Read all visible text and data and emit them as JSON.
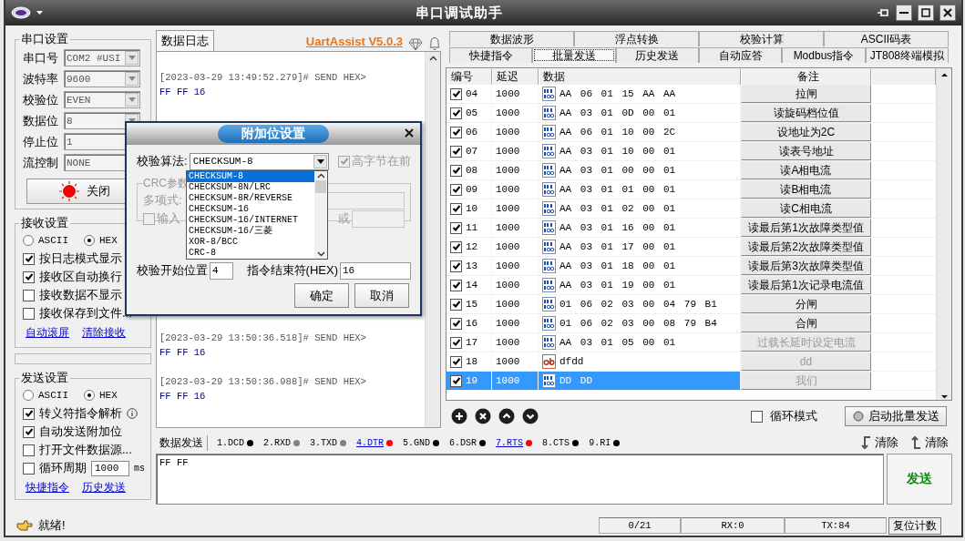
{
  "window": {
    "title": "串口调试助手"
  },
  "serial_settings": {
    "title": "串口设置",
    "fields": [
      {
        "label": "串口号",
        "value": "COM2 #USI"
      },
      {
        "label": "波特率",
        "value": "9600"
      },
      {
        "label": "校验位",
        "value": "EVEN"
      },
      {
        "label": "数据位",
        "value": "8"
      },
      {
        "label": "停止位",
        "value": "1"
      },
      {
        "label": "流控制",
        "value": "NONE"
      }
    ],
    "open_button": {
      "label": "关闭",
      "on": true
    }
  },
  "receive_settings": {
    "title": "接收设置",
    "modes": [
      {
        "label": "ASCII",
        "selected": false
      },
      {
        "label": "HEX",
        "selected": true
      }
    ],
    "options": [
      {
        "label": "按日志模式显示",
        "checked": true
      },
      {
        "label": "接收区自动换行",
        "checked": true
      },
      {
        "label": "接收数据不显示",
        "checked": false
      },
      {
        "label": "接收保存到文件...",
        "checked": false
      }
    ],
    "links": [
      "自动滚屏",
      "清除接收"
    ]
  },
  "send_settings": {
    "title": "发送设置",
    "modes": [
      {
        "label": "ASCII",
        "selected": false
      },
      {
        "label": "HEX",
        "selected": true
      }
    ],
    "options": [
      {
        "kind": "info",
        "label": "转义符指令解析",
        "checked": true
      },
      {
        "kind": "plain",
        "label": "自动发送附加位",
        "checked": true
      },
      {
        "kind": "plain",
        "label": "打开文件数据源...",
        "checked": false
      },
      {
        "kind": "period",
        "label": "循环周期",
        "checked": false,
        "value": "1000",
        "unit": "ms"
      }
    ],
    "links": [
      "快捷指令",
      "历史发送"
    ]
  },
  "log": {
    "tab": "数据日志",
    "brand": "UartAssist V5.0.3",
    "entries": [
      {
        "header": "[2023-03-29 13:49:52.279]# SEND HEX>",
        "data": "FF FF 16"
      },
      {
        "header": "[2023-03-29 13:50:36.518]# SEND HEX>",
        "data": "FF FF 16"
      },
      {
        "header": "[2023-03-29 13:50:36.988]# SEND HEX>",
        "data": "FF FF 16"
      }
    ]
  },
  "tools": {
    "tab_rows": [
      [
        {
          "label": "数据波形",
          "selected": false
        },
        {
          "label": "浮点转换",
          "selected": false
        },
        {
          "label": "校验计算",
          "selected": false
        },
        {
          "label": "ASCII码表",
          "selected": false
        }
      ],
      [
        {
          "label": "快捷指令",
          "selected": false
        },
        {
          "label": "批量发送",
          "selected": true
        },
        {
          "label": "历史发送",
          "selected": false
        },
        {
          "label": "自动应答",
          "selected": false
        },
        {
          "label": "Modbus指令",
          "selected": false
        },
        {
          "label": "JT808终端模拟",
          "selected": false
        }
      ]
    ]
  },
  "batch": {
    "columns": [
      "编号",
      "延迟",
      "数据",
      "备注"
    ],
    "rows": [
      {
        "checked": true,
        "no": "04",
        "delay": "1000",
        "kind": "hex",
        "data": "AA 06 01 15 AA AA",
        "note": "拉闸",
        "disabled": false,
        "selected": false
      },
      {
        "checked": true,
        "no": "05",
        "delay": "1000",
        "kind": "hex",
        "data": "AA 03 01 0D 00 01",
        "note": "读旋码档位值",
        "disabled": false,
        "selected": false
      },
      {
        "checked": true,
        "no": "06",
        "delay": "1000",
        "kind": "hex",
        "data": "AA 06 01 10 00 2C",
        "note": "设地址为2C",
        "disabled": false,
        "selected": false
      },
      {
        "checked": true,
        "no": "07",
        "delay": "1000",
        "kind": "hex",
        "data": "AA 03 01 10 00 01",
        "note": "读表号地址",
        "disabled": false,
        "selected": false
      },
      {
        "checked": true,
        "no": "08",
        "delay": "1000",
        "kind": "hex",
        "data": "AA 03 01 00 00 01",
        "note": "读A相电流",
        "disabled": false,
        "selected": false
      },
      {
        "checked": true,
        "no": "09",
        "delay": "1000",
        "kind": "hex",
        "data": "AA 03 01 01 00 01",
        "note": "读B相电流",
        "disabled": false,
        "selected": false
      },
      {
        "checked": true,
        "no": "10",
        "delay": "1000",
        "kind": "hex",
        "data": "AA 03 01 02 00 01",
        "note": "读C相电流",
        "disabled": false,
        "selected": false
      },
      {
        "checked": true,
        "no": "11",
        "delay": "1000",
        "kind": "hex",
        "data": "AA 03 01 16 00 01",
        "note": "读最后第1次故障类型值",
        "disabled": false,
        "selected": false
      },
      {
        "checked": true,
        "no": "12",
        "delay": "1000",
        "kind": "hex",
        "data": "AA 03 01 17 00 01",
        "note": "读最后第2次故障类型值",
        "disabled": false,
        "selected": false
      },
      {
        "checked": true,
        "no": "13",
        "delay": "1000",
        "kind": "hex",
        "data": "AA 03 01 18 00 01",
        "note": "读最后第3次故障类型值",
        "disabled": false,
        "selected": false
      },
      {
        "checked": true,
        "no": "14",
        "delay": "1000",
        "kind": "hex",
        "data": "AA 03 01 19 00 01",
        "note": "读最后第1次记录电流值",
        "disabled": false,
        "selected": false
      },
      {
        "checked": true,
        "no": "15",
        "delay": "1000",
        "kind": "hex",
        "data": "01 06 02 03 00 04 79 B1",
        "note": "分闸",
        "disabled": false,
        "selected": false
      },
      {
        "checked": true,
        "no": "16",
        "delay": "1000",
        "kind": "hex",
        "data": "01 06 02 03 00 08 79 B4",
        "note": "合闸",
        "disabled": false,
        "selected": false
      },
      {
        "checked": true,
        "no": "17",
        "delay": "1000",
        "kind": "hex",
        "data": "AA 03 01 05 00 01",
        "note": "过载长延时设定电流",
        "disabled": true,
        "selected": false
      },
      {
        "checked": true,
        "no": "18",
        "delay": "1000",
        "kind": "ascii",
        "data": "dfdd",
        "note": "dd",
        "disabled": true,
        "selected": false
      },
      {
        "checked": true,
        "no": "19",
        "delay": "1000",
        "kind": "hex",
        "data": "DD DD",
        "note": "我们",
        "disabled": true,
        "selected": true
      }
    ],
    "loop_mode": {
      "label": "循环模式",
      "checked": false
    },
    "start_button": "启动批量发送"
  },
  "send": {
    "tab": "数据发送",
    "pins": [
      {
        "label": "1.DCD",
        "color": "#000000",
        "link": false
      },
      {
        "label": "2.RXD",
        "color": "#808080",
        "link": false
      },
      {
        "label": "3.TXD",
        "color": "#808080",
        "link": false
      },
      {
        "label": "4.DTR",
        "color": "#ff0000",
        "link": true
      },
      {
        "label": "5.GND",
        "color": "#000000",
        "link": false
      },
      {
        "label": "6.DSR",
        "color": "#000000",
        "link": false
      },
      {
        "label": "7.RTS",
        "color": "#ff0000",
        "link": true
      },
      {
        "label": "8.CTS",
        "color": "#000000",
        "link": false
      },
      {
        "label": "9.RI",
        "color": "#000000",
        "link": false
      }
    ],
    "clear_buttons": [
      "清除",
      "清除"
    ],
    "input": "FF FF",
    "send_button": "发送"
  },
  "status_bar": {
    "message": "就绪!",
    "count": "0/21",
    "rx": "RX:0",
    "tx": "TX:84",
    "reset_button": "复位计数"
  },
  "dialog": {
    "title": "附加位设置",
    "algorithm_label": "校验算法:",
    "algorithm": "CHECKSUM-8",
    "high_byte_first": {
      "label": "高字节在前",
      "checked": true
    },
    "crc_group": "CRC参数",
    "polynomial_label": "多项式:",
    "input_checkbox": {
      "label": "输入",
      "checked": false
    },
    "xor_label": "或",
    "start_label": "校验开始位置",
    "start_value": "4",
    "end_label": "指令结束符(HEX)",
    "end_value": "16",
    "ok": "确定",
    "cancel": "取消",
    "options": [
      {
        "label": "CHECKSUM-8",
        "selected": true
      },
      {
        "label": "CHECKSUM-8N/LRC",
        "selected": false
      },
      {
        "label": "CHECKSUM-8R/REVERSE",
        "selected": false
      },
      {
        "label": "CHECKSUM-16",
        "selected": false
      },
      {
        "label": "CHECKSUM-16/INTERNET",
        "selected": false
      },
      {
        "label": "CHECKSUM-16/三菱",
        "selected": false
      },
      {
        "label": "XOR-8/BCC",
        "selected": false
      },
      {
        "label": "CRC-8",
        "selected": false
      }
    ]
  }
}
